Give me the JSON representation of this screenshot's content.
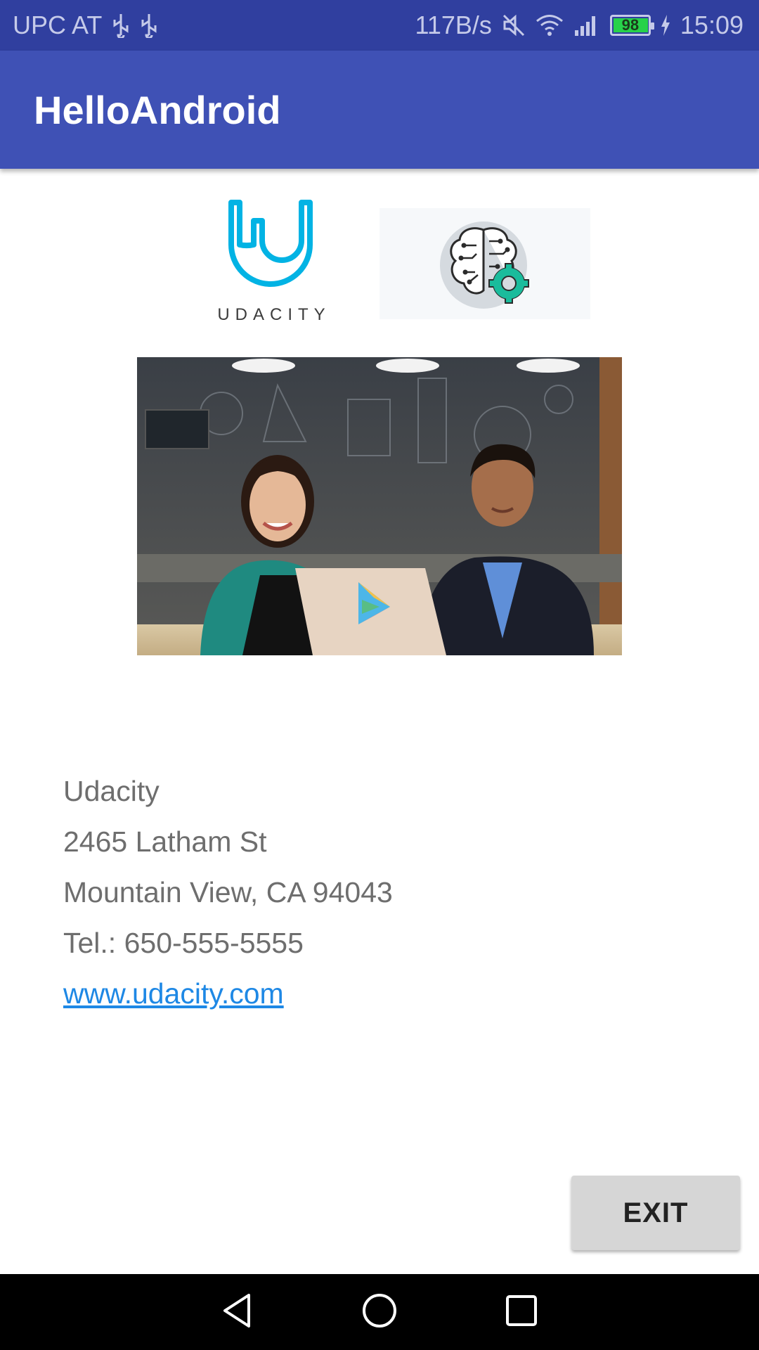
{
  "status_bar": {
    "carrier": "UPC AT",
    "net_speed": "117B/s",
    "battery_level": "98",
    "time": "15:09",
    "icons": [
      "usb-icon",
      "usb-icon",
      "mute-icon",
      "wifi-icon",
      "signal-icon",
      "battery-icon",
      "charging-icon"
    ]
  },
  "app_bar": {
    "title": "HelloAndroid"
  },
  "logos": {
    "udacity_wordmark": "UDACITY"
  },
  "contact": {
    "name": "Udacity",
    "street": "2465 Latham St",
    "city": "Mountain View, CA 94043",
    "phone": "Tel.: 650-555-5555",
    "website": "www.udacity.com"
  },
  "exit_button": {
    "label": "EXIT"
  },
  "colors": {
    "status_bar": "#303f9f",
    "app_bar": "#3f51b5",
    "udacity_blue": "#02b3e4",
    "link": "#1e88e5",
    "button": "#d6d6d6"
  }
}
